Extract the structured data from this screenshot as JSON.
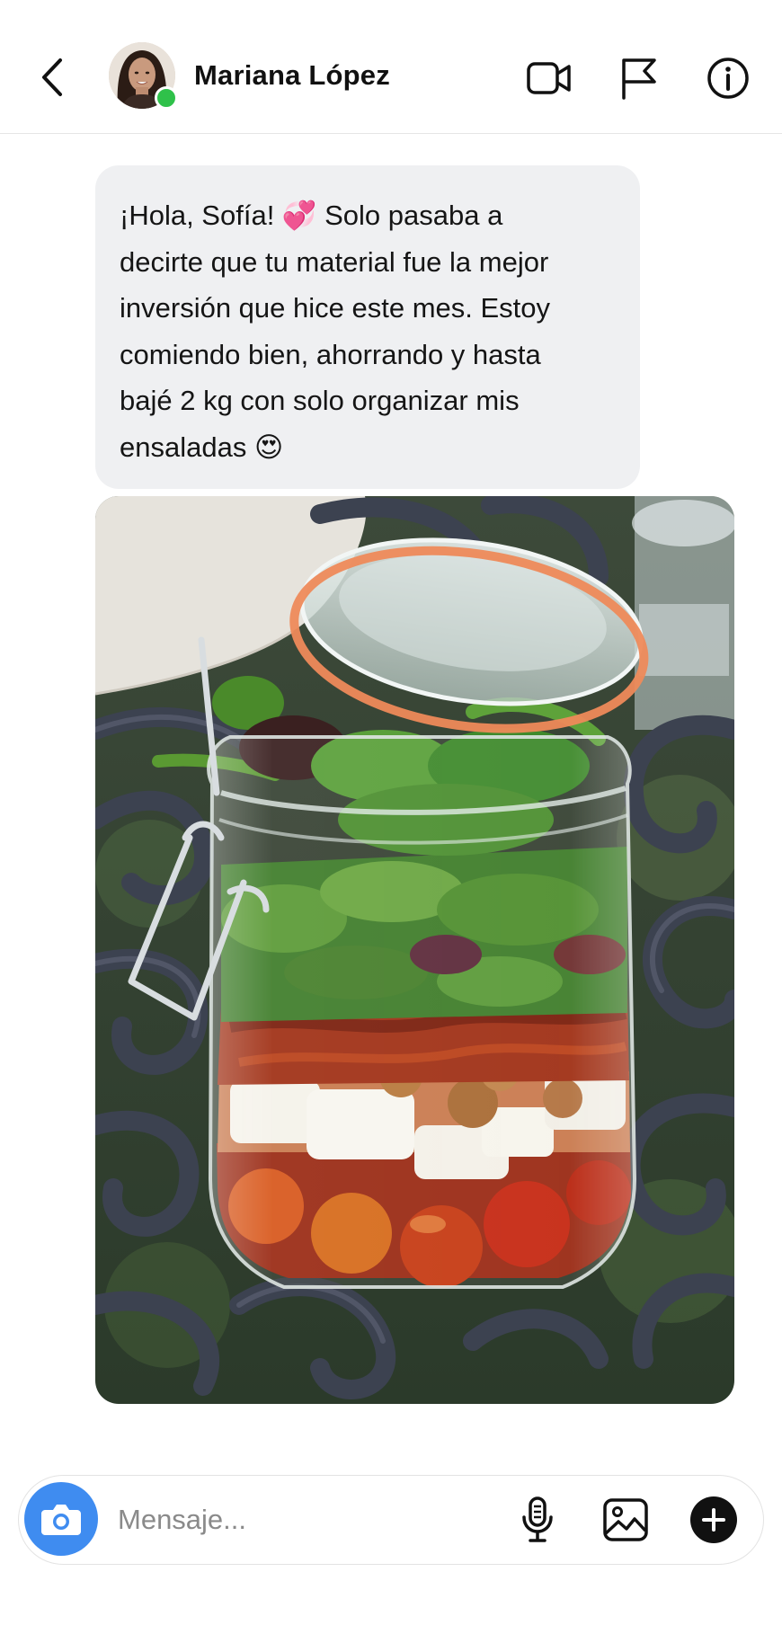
{
  "header": {
    "contact_name": "Mariana López",
    "online_status_color": "#2fc14a",
    "icons": [
      "chevron-left-icon",
      "video-call-icon",
      "flag-icon",
      "info-icon"
    ]
  },
  "conversation": {
    "messages": [
      {
        "type": "text",
        "lines": [
          "¡Hola, Sofía! 💞 Solo pasaba a",
          "decirte que tu material fue la mejor",
          "inversión que hice este mes. Estoy",
          "comiendo bien, ahorrando y hasta",
          "bajé 2 kg con solo organizar mis",
          "ensaladas 😍"
        ]
      },
      {
        "type": "image",
        "subject": "salad-jar-photo"
      }
    ]
  },
  "composer": {
    "placeholder": "Mensaje...",
    "value": "",
    "icons": [
      "camera-icon",
      "microphone-icon",
      "gallery-icon",
      "plus-icon"
    ],
    "camera_button_color": "#3f8cf0"
  }
}
